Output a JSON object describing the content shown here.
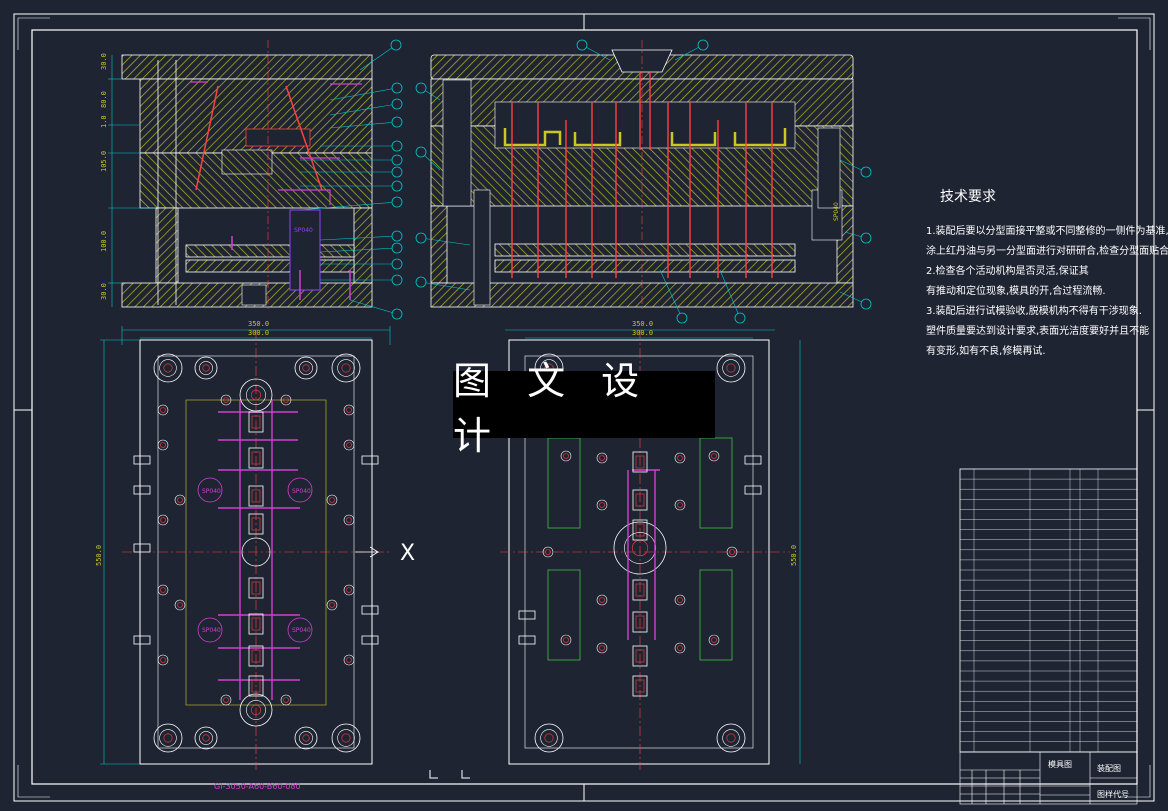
{
  "overlay": {
    "title": "图 文 设 计"
  },
  "notes": {
    "heading": "技术要求",
    "lines": [
      "1.装配后要以分型面接平整或不同整修的一侧件为基准,",
      "涂上红丹油与另一分型面进行对研研合,检查分型面贴合情况,",
      "2.检查各个活动机构是否灵活,保证其",
      "有推动和定位现象,模具的开,合过程流畅.",
      "3.装配后进行试模验收,脱模机构不得有干涉现象.",
      "塑件质量要达到设计要求,表面光洁度要好并且不能",
      "有变形,如有不良,修模再试."
    ]
  },
  "dimensions": {
    "top_width_outer": "350.0",
    "top_width_inner": "300.0",
    "top_width_outer_right": "350.0",
    "top_width_inner_right": "300.0",
    "height_left": "550.0",
    "height_right": "550.0",
    "left_section_dims": [
      "30.0",
      "80.0",
      "1.0",
      "105.0",
      "100.0",
      "30.0"
    ]
  },
  "labels": {
    "spec_a": "SP040",
    "spec_b": "SP040",
    "spec_c": "SP040",
    "spec_d": "SP040",
    "axis_mark": "X",
    "part_code": "GI-3050-A60-B60-080"
  },
  "title_block": {
    "name": "模具图",
    "drawing_label": "装配图",
    "code_label": "图样代号"
  },
  "colors": {
    "background": "#1f2433",
    "frame": "#ffffff",
    "hatch": "#c8c820",
    "dimension": "#00c8c8",
    "red": "#ff4040",
    "magenta": "#d040d0",
    "green": "#40c040",
    "cyan": "#00e0e0",
    "purple": "#9040ff"
  }
}
